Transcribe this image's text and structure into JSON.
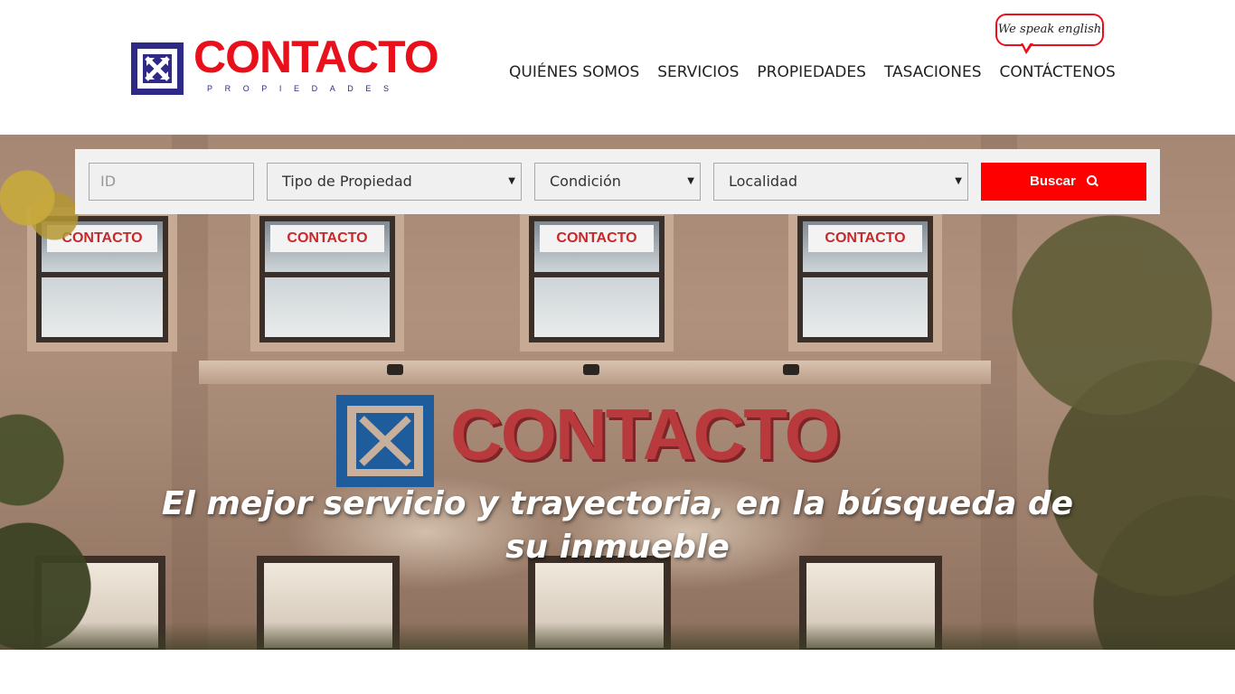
{
  "brand": {
    "name": "CONTACTO",
    "subtitle": "PROPIEDADES",
    "primary_color": "#e8101a",
    "secondary_color": "#2e2a86",
    "icon": "arrows-cross-logo-icon"
  },
  "nav": {
    "items": [
      {
        "label": "QUIÉNES SOMOS"
      },
      {
        "label": "SERVICIOS"
      },
      {
        "label": "PROPIEDADES"
      },
      {
        "label": "TASACIONES"
      },
      {
        "label": "CONTÁCTENOS"
      }
    ],
    "speech_bubble": "We speak english"
  },
  "search": {
    "id_placeholder": "ID",
    "property_type": "Tipo de Propiedad",
    "condition": "Condición",
    "locality": "Localidad",
    "button_label": "Buscar",
    "button_icon": "search-icon",
    "button_color": "#ff0000"
  },
  "hero": {
    "tagline": "El mejor servicio y trayectoria, en la búsqueda de su inmueble",
    "window_sign": "CONTACTO",
    "wall_sign": "CONTACTO"
  }
}
